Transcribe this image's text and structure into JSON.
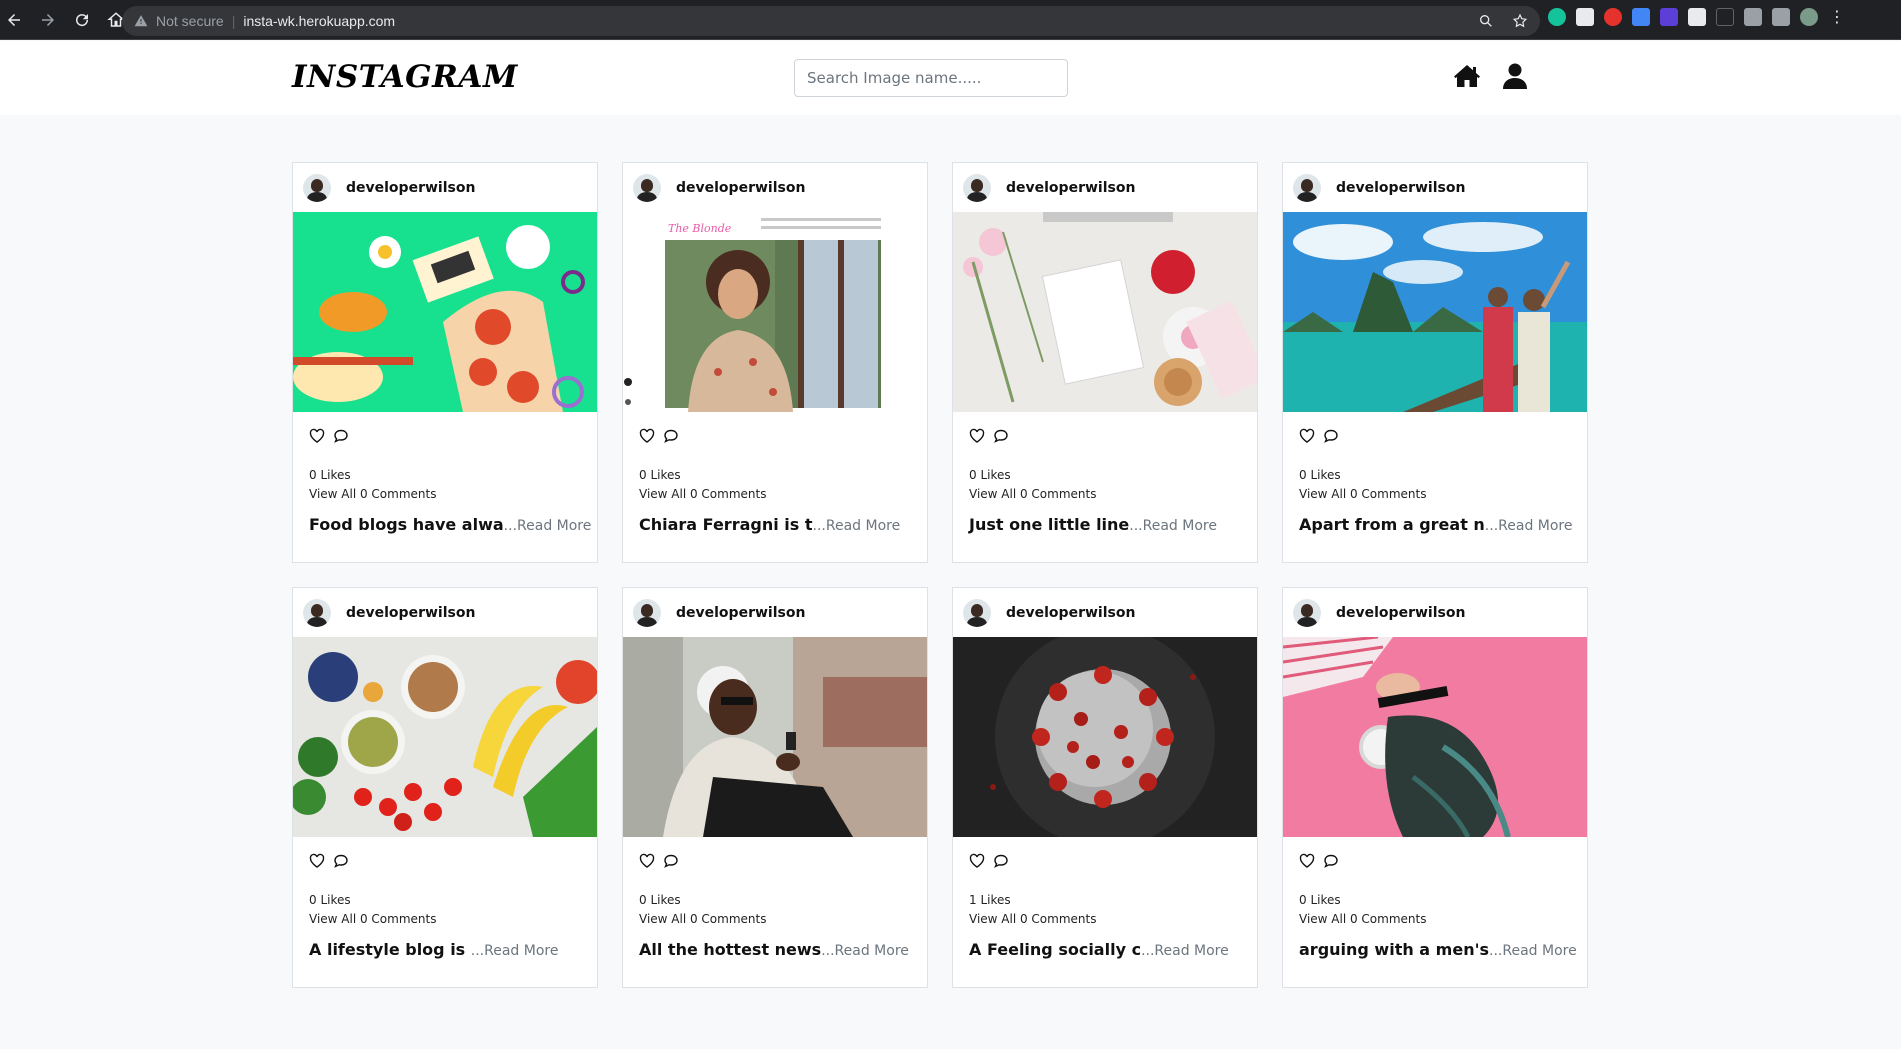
{
  "browser": {
    "security_label": "Not secure",
    "url": "insta-wk.herokuapp.com"
  },
  "navbar": {
    "brand": "INSTAGRAM",
    "search_placeholder": "Search Image name.....",
    "home_icon": "home-icon",
    "profile_icon": "user-icon"
  },
  "posts": [
    {
      "username": "developerwilson",
      "image": "food-illustration",
      "likes": "0 Likes",
      "comments": "View All 0 Comments",
      "caption": "Food blogs have alwa",
      "read_more": "...Read More"
    },
    {
      "username": "developerwilson",
      "image": "blog-screenshot-woman",
      "likes": "0 Likes",
      "comments": "View All 0 Comments",
      "caption": "Chiara Ferragni is t",
      "read_more": "...Read More"
    },
    {
      "username": "developerwilson",
      "image": "desk-flatlay",
      "likes": "0 Likes",
      "comments": "View All 0 Comments",
      "caption": "Just one little line",
      "read_more": "...Read More"
    },
    {
      "username": "developerwilson",
      "image": "travel-lagoon",
      "likes": "0 Likes",
      "comments": "View All 0 Comments",
      "caption": "Apart from a great n",
      "read_more": "...Read More"
    },
    {
      "username": "developerwilson",
      "image": "fruits-vegetables",
      "likes": "0 Likes",
      "comments": "View All 0 Comments",
      "caption": "A lifestyle blog is ",
      "read_more": "...Read More"
    },
    {
      "username": "developerwilson",
      "image": "man-headphones-phone",
      "likes": "0 Likes",
      "comments": "View All 0 Comments",
      "caption": "All the hottest news",
      "read_more": "...Read More"
    },
    {
      "username": "developerwilson",
      "image": "coronavirus",
      "likes": "1 Likes",
      "comments": "View All 0 Comments",
      "caption": "A Feeling socially c",
      "read_more": "...Read More"
    },
    {
      "username": "developerwilson",
      "image": "woman-headphones-pink",
      "likes": "0 Likes",
      "comments": "View All 0 Comments",
      "caption": "arguing with a men's",
      "read_more": "...Read More"
    }
  ]
}
